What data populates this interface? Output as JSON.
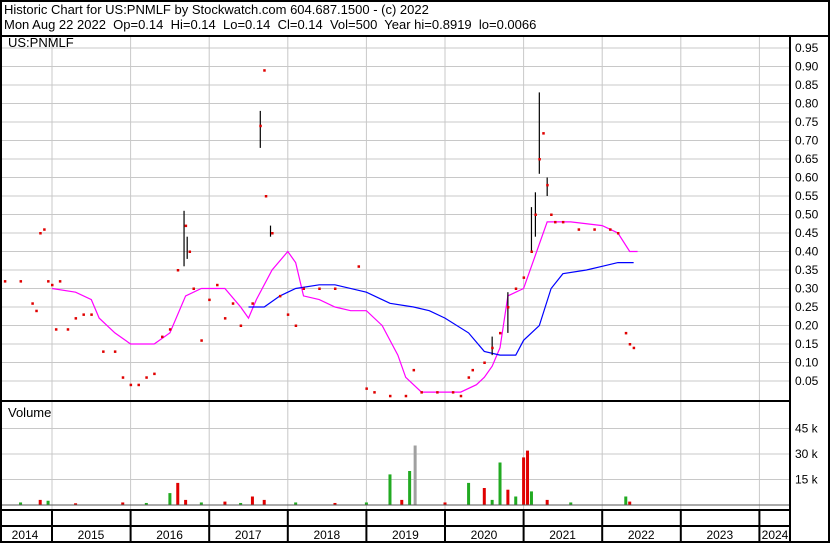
{
  "header": {
    "line1": "Historic Chart for US:PNMLF by Stockwatch.com 604.687.1500 - (c) 2022",
    "line2": "Mon Aug 22 2022  Op=0.14  Hi=0.14  Lo=0.14  Cl=0.14  Vol=500  Year hi=0.8919  lo=0.0066"
  },
  "colors": {
    "close": "#e00000",
    "ma_short": "#ff00ff",
    "ma_long": "#0000ff",
    "vol_up": "#22aa22",
    "vol_down": "#e00000",
    "vol_other": "#a0a0a0",
    "grid": "#c8c8c8"
  },
  "chart_data": [
    {
      "type": "scatter",
      "title": "US:PNMLF",
      "ylim": [
        0,
        0.975
      ],
      "xlim": [
        2014.35,
        2024.45
      ],
      "yticks": [
        0.05,
        0.1,
        0.15,
        0.2,
        0.25,
        0.3,
        0.35,
        0.4,
        0.45,
        0.5,
        0.55,
        0.6,
        0.65,
        0.7,
        0.75,
        0.8,
        0.85,
        0.9,
        0.95
      ],
      "ytick_labels": [
        "0.05",
        "0.10",
        "0.15",
        "0.20",
        "0.25",
        "0.30",
        "0.35",
        "0.40",
        "0.45",
        "0.50",
        "0.55",
        "0.60",
        "0.65",
        "0.70",
        "0.75",
        "0.80",
        "0.85",
        "0.90",
        "0.95"
      ],
      "close": [
        [
          2014.4,
          0.32
        ],
        [
          2014.6,
          0.32
        ],
        [
          2014.75,
          0.26
        ],
        [
          2014.8,
          0.24
        ],
        [
          2014.85,
          0.45
        ],
        [
          2014.9,
          0.46
        ],
        [
          2014.95,
          0.32
        ],
        [
          2015.0,
          0.31
        ],
        [
          2015.1,
          0.32
        ],
        [
          2015.05,
          0.19
        ],
        [
          2015.2,
          0.19
        ],
        [
          2015.3,
          0.22
        ],
        [
          2015.4,
          0.23
        ],
        [
          2015.5,
          0.23
        ],
        [
          2015.65,
          0.13
        ],
        [
          2015.8,
          0.13
        ],
        [
          2015.9,
          0.06
        ],
        [
          2016.0,
          0.04
        ],
        [
          2016.1,
          0.04
        ],
        [
          2016.2,
          0.06
        ],
        [
          2016.3,
          0.07
        ],
        [
          2016.4,
          0.17
        ],
        [
          2016.5,
          0.19
        ],
        [
          2016.6,
          0.35
        ],
        [
          2016.7,
          0.47
        ],
        [
          2016.75,
          0.4
        ],
        [
          2016.8,
          0.3
        ],
        [
          2016.9,
          0.16
        ],
        [
          2017.0,
          0.27
        ],
        [
          2017.1,
          0.31
        ],
        [
          2017.2,
          0.22
        ],
        [
          2017.3,
          0.26
        ],
        [
          2017.4,
          0.2
        ],
        [
          2017.55,
          0.26
        ],
        [
          2017.65,
          0.74
        ],
        [
          2017.7,
          0.89
        ],
        [
          2017.72,
          0.55
        ],
        [
          2017.8,
          0.45
        ],
        [
          2017.9,
          0.28
        ],
        [
          2018.0,
          0.23
        ],
        [
          2018.1,
          0.2
        ],
        [
          2018.2,
          0.3
        ],
        [
          2018.4,
          0.3
        ],
        [
          2018.6,
          0.3
        ],
        [
          2018.9,
          0.36
        ],
        [
          2019.0,
          0.03
        ],
        [
          2019.1,
          0.02
        ],
        [
          2019.3,
          0.01
        ],
        [
          2019.5,
          0.01
        ],
        [
          2019.6,
          0.08
        ],
        [
          2019.7,
          0.02
        ],
        [
          2019.9,
          0.02
        ],
        [
          2020.1,
          0.02
        ],
        [
          2020.2,
          0.01
        ],
        [
          2020.3,
          0.06
        ],
        [
          2020.35,
          0.08
        ],
        [
          2020.5,
          0.1
        ],
        [
          2020.6,
          0.14
        ],
        [
          2020.7,
          0.18
        ],
        [
          2020.8,
          0.25
        ],
        [
          2020.9,
          0.3
        ],
        [
          2021.0,
          0.33
        ],
        [
          2021.1,
          0.4
        ],
        [
          2021.15,
          0.5
        ],
        [
          2021.2,
          0.65
        ],
        [
          2021.25,
          0.72
        ],
        [
          2021.3,
          0.58
        ],
        [
          2021.35,
          0.5
        ],
        [
          2021.4,
          0.48
        ],
        [
          2021.5,
          0.48
        ],
        [
          2021.7,
          0.46
        ],
        [
          2021.9,
          0.46
        ],
        [
          2022.1,
          0.46
        ],
        [
          2022.2,
          0.45
        ],
        [
          2022.3,
          0.18
        ],
        [
          2022.35,
          0.15
        ],
        [
          2022.4,
          0.14
        ]
      ],
      "hilo": [
        [
          2016.68,
          0.36,
          0.51
        ],
        [
          2016.72,
          0.38,
          0.44
        ],
        [
          2017.65,
          0.68,
          0.78
        ],
        [
          2017.78,
          0.44,
          0.47
        ],
        [
          2020.6,
          0.12,
          0.17
        ],
        [
          2020.8,
          0.18,
          0.29
        ],
        [
          2021.1,
          0.4,
          0.52
        ],
        [
          2021.15,
          0.44,
          0.56
        ],
        [
          2021.2,
          0.61,
          0.83
        ],
        [
          2021.3,
          0.55,
          0.6
        ]
      ],
      "series": [
        {
          "name": "ma_short",
          "values": [
            [
              2015.0,
              0.3
            ],
            [
              2015.3,
              0.29
            ],
            [
              2015.5,
              0.27
            ],
            [
              2015.6,
              0.22
            ],
            [
              2015.8,
              0.18
            ],
            [
              2016.0,
              0.15
            ],
            [
              2016.3,
              0.15
            ],
            [
              2016.5,
              0.18
            ],
            [
              2016.7,
              0.28
            ],
            [
              2016.9,
              0.3
            ],
            [
              2017.2,
              0.3
            ],
            [
              2017.4,
              0.25
            ],
            [
              2017.5,
              0.22
            ],
            [
              2017.6,
              0.27
            ],
            [
              2017.8,
              0.35
            ],
            [
              2018.0,
              0.4
            ],
            [
              2018.1,
              0.37
            ],
            [
              2018.2,
              0.28
            ],
            [
              2018.4,
              0.27
            ],
            [
              2018.6,
              0.25
            ],
            [
              2018.8,
              0.24
            ],
            [
              2019.0,
              0.24
            ],
            [
              2019.2,
              0.2
            ],
            [
              2019.4,
              0.12
            ],
            [
              2019.5,
              0.06
            ],
            [
              2019.7,
              0.02
            ],
            [
              2020.0,
              0.02
            ],
            [
              2020.2,
              0.02
            ],
            [
              2020.4,
              0.04
            ],
            [
              2020.5,
              0.06
            ],
            [
              2020.6,
              0.09
            ],
            [
              2020.7,
              0.14
            ],
            [
              2020.8,
              0.28
            ],
            [
              2021.0,
              0.3
            ],
            [
              2021.2,
              0.42
            ],
            [
              2021.3,
              0.48
            ],
            [
              2021.6,
              0.48
            ],
            [
              2022.0,
              0.47
            ],
            [
              2022.2,
              0.45
            ],
            [
              2022.35,
              0.4
            ],
            [
              2022.45,
              0.4
            ]
          ]
        },
        {
          "name": "ma_long",
          "values": [
            [
              2017.5,
              0.25
            ],
            [
              2017.7,
              0.25
            ],
            [
              2017.9,
              0.28
            ],
            [
              2018.1,
              0.3
            ],
            [
              2018.4,
              0.31
            ],
            [
              2018.6,
              0.31
            ],
            [
              2019.0,
              0.29
            ],
            [
              2019.3,
              0.26
            ],
            [
              2019.6,
              0.25
            ],
            [
              2019.8,
              0.24
            ],
            [
              2020.0,
              0.22
            ],
            [
              2020.3,
              0.18
            ],
            [
              2020.5,
              0.13
            ],
            [
              2020.7,
              0.12
            ],
            [
              2020.9,
              0.12
            ],
            [
              2021.0,
              0.16
            ],
            [
              2021.2,
              0.2
            ],
            [
              2021.35,
              0.3
            ],
            [
              2021.5,
              0.34
            ],
            [
              2021.8,
              0.35
            ],
            [
              2022.0,
              0.36
            ],
            [
              2022.2,
              0.37
            ],
            [
              2022.4,
              0.37
            ]
          ]
        }
      ]
    },
    {
      "type": "bar",
      "title": "Volume",
      "ylim": [
        0,
        52000
      ],
      "yticks": [
        15000,
        30000,
        45000
      ],
      "ytick_labels": [
        "15 k",
        "30 k",
        "45 k"
      ],
      "bars": [
        [
          2014.6,
          1500,
          "up"
        ],
        [
          2014.85,
          3000,
          "down"
        ],
        [
          2014.95,
          2500,
          "up"
        ],
        [
          2015.3,
          1000,
          "down"
        ],
        [
          2015.9,
          1500,
          "down"
        ],
        [
          2016.2,
          1200,
          "up"
        ],
        [
          2016.5,
          7000,
          "up"
        ],
        [
          2016.6,
          13000,
          "down"
        ],
        [
          2016.7,
          3000,
          "down"
        ],
        [
          2016.9,
          1500,
          "up"
        ],
        [
          2017.2,
          2000,
          "down"
        ],
        [
          2017.4,
          1200,
          "up"
        ],
        [
          2017.55,
          5000,
          "down"
        ],
        [
          2017.7,
          3000,
          "down"
        ],
        [
          2018.1,
          1500,
          "up"
        ],
        [
          2018.6,
          1200,
          "down"
        ],
        [
          2019.0,
          1500,
          "up"
        ],
        [
          2019.3,
          18000,
          "up"
        ],
        [
          2019.45,
          3000,
          "down"
        ],
        [
          2019.55,
          20000,
          "up"
        ],
        [
          2019.62,
          35000,
          "other"
        ],
        [
          2020.0,
          1500,
          "down"
        ],
        [
          2020.3,
          13000,
          "up"
        ],
        [
          2020.5,
          10000,
          "down"
        ],
        [
          2020.6,
          3000,
          "up"
        ],
        [
          2020.7,
          25000,
          "up"
        ],
        [
          2020.8,
          9000,
          "down"
        ],
        [
          2020.9,
          5000,
          "up"
        ],
        [
          2021.0,
          28000,
          "down"
        ],
        [
          2021.05,
          32000,
          "down"
        ],
        [
          2021.1,
          8000,
          "up"
        ],
        [
          2021.3,
          3000,
          "down"
        ],
        [
          2021.6,
          1500,
          "up"
        ],
        [
          2022.3,
          5000,
          "up"
        ],
        [
          2022.35,
          2000,
          "down"
        ]
      ]
    },
    {
      "type": "axis",
      "years": [
        "2014",
        "2015",
        "2016",
        "2017",
        "2018",
        "2019",
        "2020",
        "2021",
        "2022",
        "2023",
        "2024"
      ],
      "year_starts": [
        2014,
        2015,
        2016,
        2017,
        2018,
        2019,
        2020,
        2021,
        2022,
        2023,
        2024
      ]
    }
  ]
}
